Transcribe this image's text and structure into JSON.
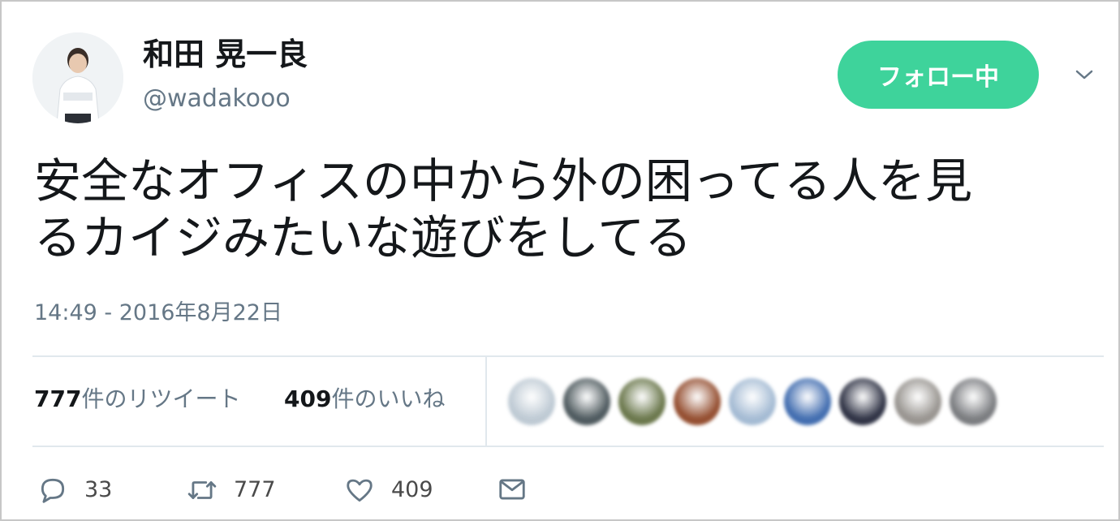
{
  "user": {
    "display_name": "和田 晃一良",
    "screen_name": "@wadakooo"
  },
  "follow_button": {
    "label": "フォロー中",
    "color": "#3ed39b"
  },
  "tweet": {
    "text_line1": "安全なオフィスの中から外の困ってる人を見",
    "text_line2": "るカイジみたいな遊びをしてる",
    "timestamp": "14:49 - 2016年8月22日"
  },
  "stats": {
    "retweets_count": "777",
    "retweets_label": "件のリツイート",
    "likes_count": "409",
    "likes_label": "件のいいね"
  },
  "liker_avatars": [
    {
      "color": "#b7c4cf"
    },
    {
      "color": "#3d4a4f"
    },
    {
      "color": "#5c6a3a"
    },
    {
      "color": "#8a3d1c"
    },
    {
      "color": "#9bb4cf"
    },
    {
      "color": "#2f5fa8"
    },
    {
      "color": "#1b1f33"
    },
    {
      "color": "#8e8a85"
    },
    {
      "color": "#6d6f73"
    }
  ],
  "actions": {
    "reply_count": "33",
    "retweet_count": "777",
    "like_count": "409"
  },
  "icons": [
    "reply-icon",
    "retweet-icon",
    "heart-icon",
    "envelope-icon",
    "chevron-down-icon"
  ]
}
